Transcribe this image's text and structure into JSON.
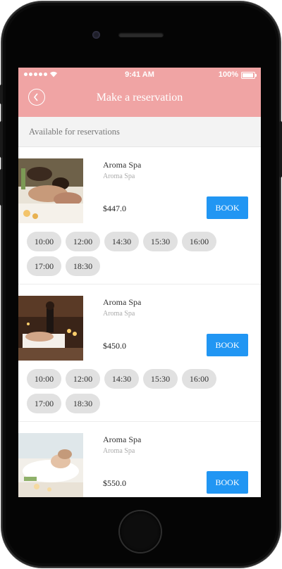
{
  "status_bar": {
    "time": "9:41 AM",
    "battery": "100%"
  },
  "header": {
    "title": "Make a reservation"
  },
  "subheader": {
    "text": "Available for reservations"
  },
  "listings": [
    {
      "name": "Aroma Spa",
      "subtitle": "Aroma Spa",
      "price": "$447.0",
      "book_label": "BOOK",
      "times": [
        "10:00",
        "12:00",
        "14:30",
        "15:30",
        "16:00",
        "17:00",
        "18:30"
      ]
    },
    {
      "name": "Aroma Spa",
      "subtitle": "Aroma Spa",
      "price": "$450.0",
      "book_label": "BOOK",
      "times": [
        "10:00",
        "12:00",
        "14:30",
        "15:30",
        "16:00",
        "17:00",
        "18:30"
      ]
    },
    {
      "name": "Aroma Spa",
      "subtitle": "Aroma Spa",
      "price": "$550.0",
      "book_label": "BOOK",
      "times": []
    }
  ],
  "colors": {
    "header": "#f0a4a4",
    "book_button": "#2196f3",
    "slot": "#e1e1e1"
  }
}
